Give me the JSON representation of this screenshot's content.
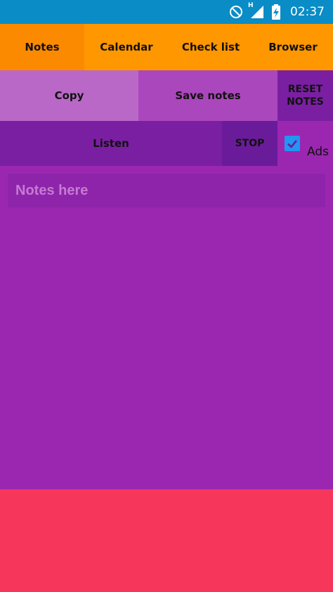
{
  "status_bar": {
    "time": "02:37",
    "network_letter": "H"
  },
  "tabs": [
    {
      "label": "Notes"
    },
    {
      "label": "Calendar"
    },
    {
      "label": "Check list"
    },
    {
      "label": "Browser"
    }
  ],
  "actions": {
    "copy": "Copy",
    "save": "Save notes",
    "reset_line1": "RESET",
    "reset_line2": "NOTES",
    "listen": "Listen",
    "stop": "STOP"
  },
  "ads_toggle": {
    "label": "Ads",
    "checked": true
  },
  "notes_input": {
    "placeholder": "Notes here",
    "value": ""
  },
  "colors": {
    "status_bar": "#0a8cc6",
    "tabs": "#fe9700",
    "background": "#9b27b0",
    "ad_area": "#f6375b",
    "checkbox": "#2196f3"
  },
  "icons": {
    "dnd": "do-not-disturb-icon",
    "signal": "cell-signal-icon",
    "battery": "battery-charging-icon"
  }
}
